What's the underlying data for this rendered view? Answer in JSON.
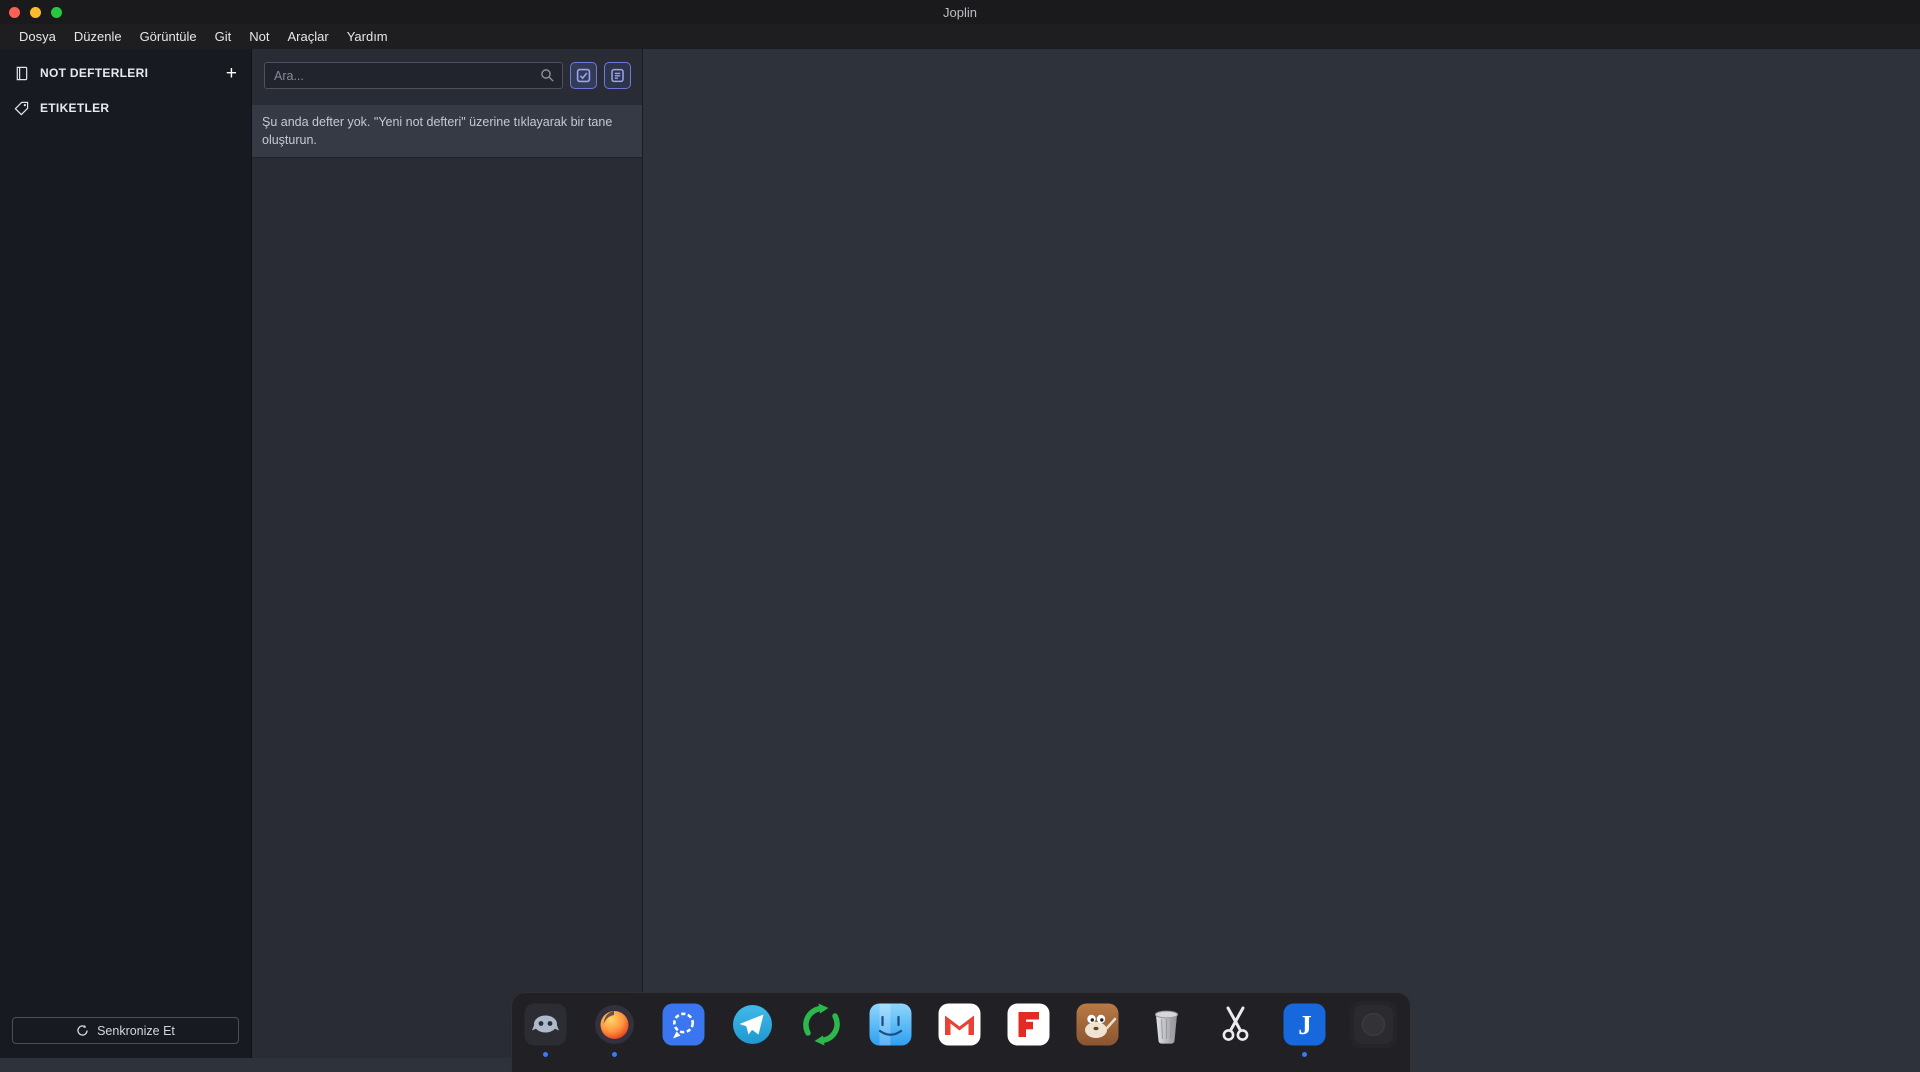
{
  "window": {
    "title": "Joplin"
  },
  "menu": {
    "items": [
      "Dosya",
      "Düzenle",
      "Görüntüle",
      "Git",
      "Not",
      "Araçlar",
      "Yardım"
    ]
  },
  "sidebar": {
    "notebooks": {
      "label": "NOT DEFTERLERI",
      "icon": "notebook-icon",
      "add_icon": "plus-icon",
      "add_glyph": "+"
    },
    "tags": {
      "label": "ETIKETLER",
      "icon": "tag-icon"
    },
    "sync_button": {
      "label": "Senkronize Et",
      "icon": "sync-icon"
    }
  },
  "notes_panel": {
    "search": {
      "placeholder": "Ara...",
      "icon": "search-icon"
    },
    "new_todo_button": {
      "icon": "new-todo-icon"
    },
    "new_note_button": {
      "icon": "new-note-icon"
    },
    "empty_message": "Şu anda defter yok. \"Yeni not defteri\" üzerine tıklayarak bir tane oluşturun."
  },
  "dock": {
    "items": [
      "discord",
      "firefox",
      "signal",
      "telegram",
      "freefilesync",
      "finder",
      "gmail",
      "flipboard",
      "gimp",
      "trash",
      "scissors",
      "joplin",
      "placeholder"
    ],
    "running": [
      "discord",
      "firefox",
      "joplin"
    ]
  },
  "colors": {
    "accent_blue": "#6f79da",
    "running_dot": "#3b7af0",
    "joplin_blue": "#1668dc"
  }
}
